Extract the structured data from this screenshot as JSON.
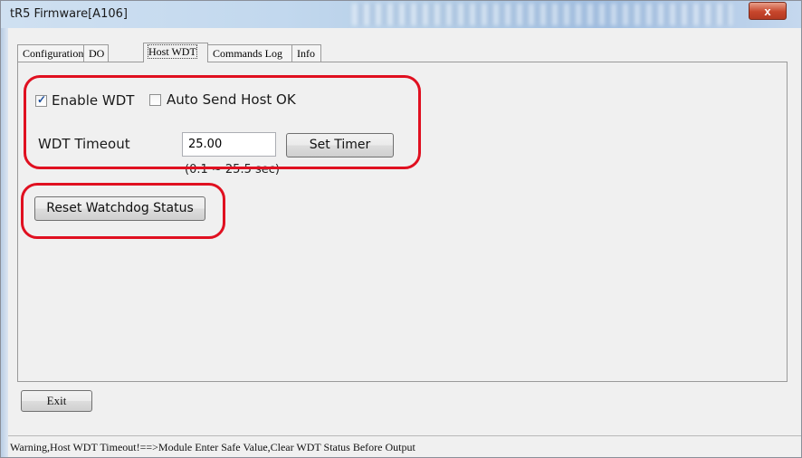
{
  "window": {
    "title": "tR5 Firmware[A106]",
    "close_glyph": "x"
  },
  "tabs": [
    {
      "label": "Configuration",
      "active": false
    },
    {
      "label": "DO",
      "active": false
    },
    {
      "label": "Host WDT",
      "active": true
    },
    {
      "label": "Commands Log",
      "active": false
    },
    {
      "label": "Info",
      "active": false
    }
  ],
  "wdt": {
    "enable_label": "Enable WDT",
    "enable_checked": true,
    "auto_send_label": "Auto Send Host OK",
    "auto_send_checked": false,
    "timeout_label": "WDT Timeout",
    "timeout_value": "25.00",
    "set_timer_label": "Set Timer",
    "range_hint": "(0.1 ~ 25.5 sec)",
    "reset_label": "Reset Watchdog Status"
  },
  "footer": {
    "exit_label": "Exit"
  },
  "status": {
    "text": "Warning,Host WDT Timeout!==>Module Enter Safe Value,Clear WDT Status Before Output"
  },
  "colors": {
    "annotation": "#e01020",
    "checkmark": "#1e4f9c"
  }
}
